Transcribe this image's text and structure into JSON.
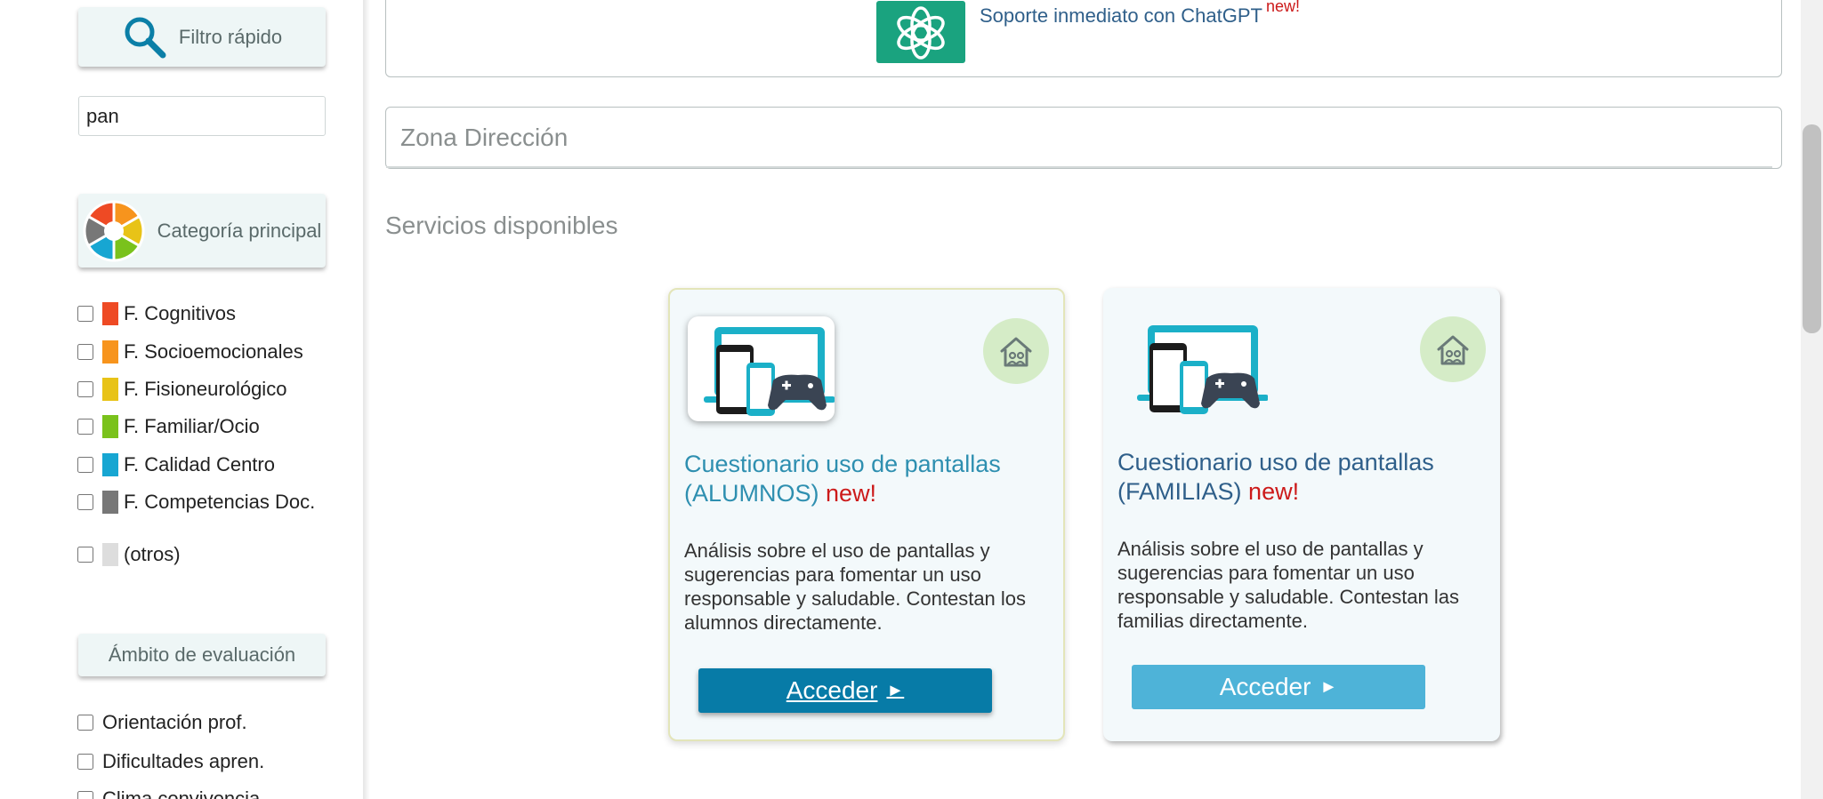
{
  "sidebar": {
    "quick_filter": {
      "label": "Filtro rápido",
      "icon": "search-icon"
    },
    "search": {
      "value": "pan"
    },
    "main_category": {
      "label": "Categoría principal",
      "icon": "category-wheel-icon"
    },
    "categories": [
      {
        "label": "F. Cognitivos",
        "color": "#ee4a24"
      },
      {
        "label": "F. Socioemocionales",
        "color": "#f7941d"
      },
      {
        "label": "F. Fisioneurológico",
        "color": "#e8c317"
      },
      {
        "label": "F. Familiar/Ocio",
        "color": "#7ac21c"
      },
      {
        "label": "F. Calidad Centro",
        "color": "#17a6d2"
      },
      {
        "label": "F. Competencias Doc.",
        "color": "#777777"
      },
      {
        "label": "(otros)",
        "color": "#dddddd"
      }
    ],
    "scope": {
      "label": "Ámbito de evaluación",
      "items": [
        {
          "label": "Orientación prof."
        },
        {
          "label": "Dificultades apren."
        },
        {
          "label": "Clima convivencia"
        }
      ]
    }
  },
  "main": {
    "support": {
      "text": "Soporte inmediato con ChatGPT",
      "new": "new!",
      "icon": "chatgpt-logo-icon"
    },
    "zone": {
      "title": "Zona Dirección"
    },
    "services_title": "Servicios disponibles",
    "cards": [
      {
        "title": "Cuestionario uso de pantallas",
        "title_suffix": "(ALUMNOS)",
        "new": "new!",
        "description": "Análisis sobre el uso de pantallas y sugerencias para fomentar un uso responsable y saludable. Contestan los alumnos directamente.",
        "button": "Acceder",
        "button_arrow": "►"
      },
      {
        "title": "Cuestionario uso de pantallas",
        "title_suffix": "(FAMILIAS)",
        "new": "new!",
        "description": "Análisis sobre el uso de pantallas y sugerencias para fomentar un uso responsable y saludable. Contestan las familias directamente.",
        "button": "Acceder",
        "button_arrow": "►"
      }
    ]
  },
  "colors": {
    "accent_blue": "#077ba7",
    "accent_light_blue": "#4eb3d8",
    "new_red": "#cc1a1a",
    "chatgpt_green": "#1aa37f"
  }
}
